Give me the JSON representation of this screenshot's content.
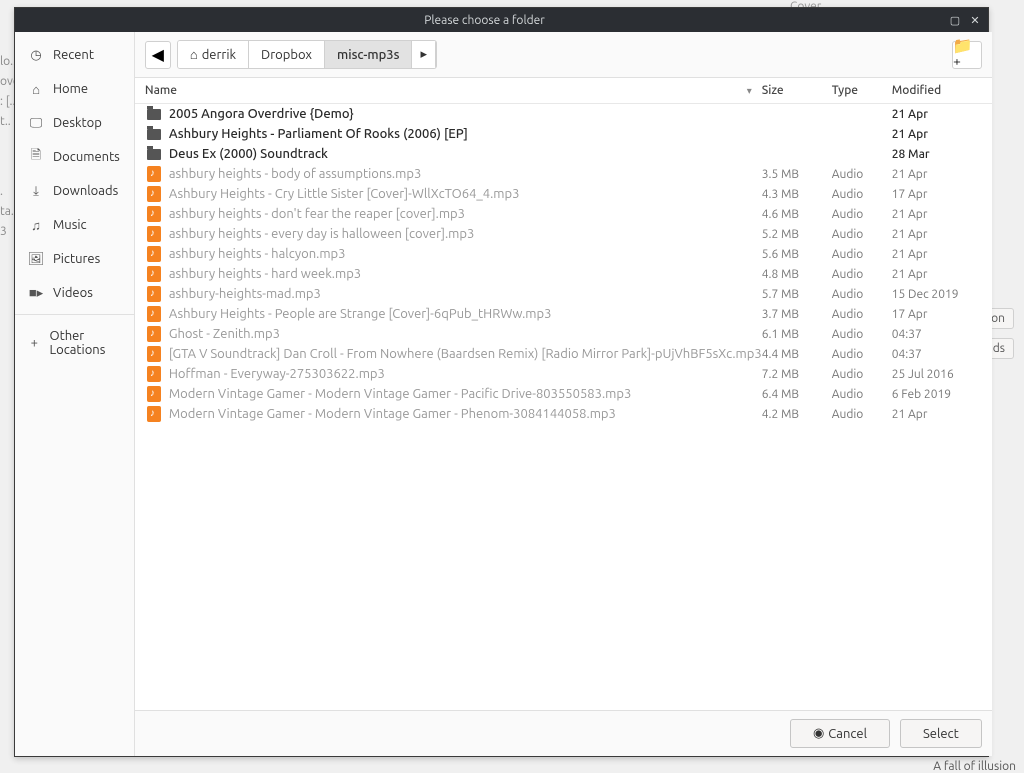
{
  "bg": {
    "cover": "Cover",
    "a": "lo..",
    "b": "ove",
    "c": ": [...",
    "d": "t..",
    "e": ".",
    "f": "ta...",
    "g": "3",
    "btnX": "on",
    "btnY": "nds",
    "status": "A fall of illusion"
  },
  "titlebar": {
    "title": "Please choose a folder"
  },
  "sidebar": {
    "items": [
      {
        "icon": "clock-icon",
        "glyph": "◷",
        "label": "Recent"
      },
      {
        "icon": "home-icon",
        "glyph": "⌂",
        "label": "Home"
      },
      {
        "icon": "desktop-icon",
        "glyph": "🖵",
        "label": "Desktop"
      },
      {
        "icon": "documents-icon",
        "glyph": "🗎",
        "label": "Documents"
      },
      {
        "icon": "downloads-icon",
        "glyph": "⤓",
        "label": "Downloads"
      },
      {
        "icon": "music-icon",
        "glyph": "♫",
        "label": "Music"
      },
      {
        "icon": "pictures-icon",
        "glyph": "🖼",
        "label": "Pictures"
      },
      {
        "icon": "videos-icon",
        "glyph": "■▸",
        "label": "Videos"
      }
    ],
    "other": {
      "icon": "plus-icon",
      "glyph": "+",
      "label": "Other Locations"
    }
  },
  "path": {
    "back_glyph": "◀",
    "home_glyph": "⌂",
    "crumbs": [
      {
        "label": "derrik",
        "active": false,
        "home": true
      },
      {
        "label": "Dropbox",
        "active": false,
        "home": false
      },
      {
        "label": "misc-mp3s",
        "active": true,
        "home": false
      }
    ],
    "forward_glyph": "▸",
    "newfolder_glyph": "📁⁺"
  },
  "columns": {
    "name": "Name",
    "size": "Size",
    "type": "Type",
    "modified": "Modified",
    "sort_glyph": "▾"
  },
  "files": [
    {
      "kind": "folder",
      "name": "2005 Angora Overdrive {Demo}",
      "size": "",
      "type": "",
      "modified": "21 Apr"
    },
    {
      "kind": "folder",
      "name": "Ashbury Heights - Parliament Of Rooks (2006) [EP]",
      "size": "",
      "type": "",
      "modified": "21 Apr"
    },
    {
      "kind": "folder",
      "name": "Deus Ex (2000) Soundtrack",
      "size": "",
      "type": "",
      "modified": "28 Mar"
    },
    {
      "kind": "audio",
      "name": "ashbury heights - body of assumptions.mp3",
      "size": "3.5 MB",
      "type": "Audio",
      "modified": "21 Apr"
    },
    {
      "kind": "audio",
      "name": "Ashbury Heights - Cry Little Sister [Cover]-WllXcTO64_4.mp3",
      "size": "4.3 MB",
      "type": "Audio",
      "modified": "17 Apr"
    },
    {
      "kind": "audio",
      "name": "ashbury heights - don't fear the reaper [cover].mp3",
      "size": "4.6 MB",
      "type": "Audio",
      "modified": "21 Apr"
    },
    {
      "kind": "audio",
      "name": "ashbury heights - every day is halloween [cover].mp3",
      "size": "5.2 MB",
      "type": "Audio",
      "modified": "21 Apr"
    },
    {
      "kind": "audio",
      "name": "ashbury heights - halcyon.mp3",
      "size": "5.6 MB",
      "type": "Audio",
      "modified": "21 Apr"
    },
    {
      "kind": "audio",
      "name": "ashbury heights - hard week.mp3",
      "size": "4.8 MB",
      "type": "Audio",
      "modified": "21 Apr"
    },
    {
      "kind": "audio",
      "name": "ashbury-heights-mad.mp3",
      "size": "5.7 MB",
      "type": "Audio",
      "modified": "15 Dec 2019"
    },
    {
      "kind": "audio",
      "name": "Ashbury Heights - People are Strange [Cover]-6qPub_tHRWw.mp3",
      "size": "3.7 MB",
      "type": "Audio",
      "modified": "17 Apr"
    },
    {
      "kind": "audio",
      "name": "Ghost - Zenith.mp3",
      "size": "6.1 MB",
      "type": "Audio",
      "modified": "04:37"
    },
    {
      "kind": "audio",
      "name": "[GTA V Soundtrack] Dan Croll - From Nowhere (Baardsen Remix) [Radio Mirror Park]-pUjVhBF5sXc.mp3",
      "size": "4.4 MB",
      "type": "Audio",
      "modified": "04:37"
    },
    {
      "kind": "audio",
      "name": "Hoffman - Everyway-275303622.mp3",
      "size": "7.2 MB",
      "type": "Audio",
      "modified": "25 Jul 2016"
    },
    {
      "kind": "audio",
      "name": "Modern Vintage Gamer - Modern Vintage Gamer - Pacific Drive-803550583.mp3",
      "size": "6.4 MB",
      "type": "Audio",
      "modified": "6 Feb 2019"
    },
    {
      "kind": "audio",
      "name": "Modern Vintage Gamer - Modern Vintage Gamer - Phenom-3084144058.mp3",
      "size": "4.2 MB",
      "type": "Audio",
      "modified": "21 Apr"
    }
  ],
  "footer": {
    "cancel": "Cancel",
    "cancel_glyph": "◉",
    "select": "Select"
  }
}
